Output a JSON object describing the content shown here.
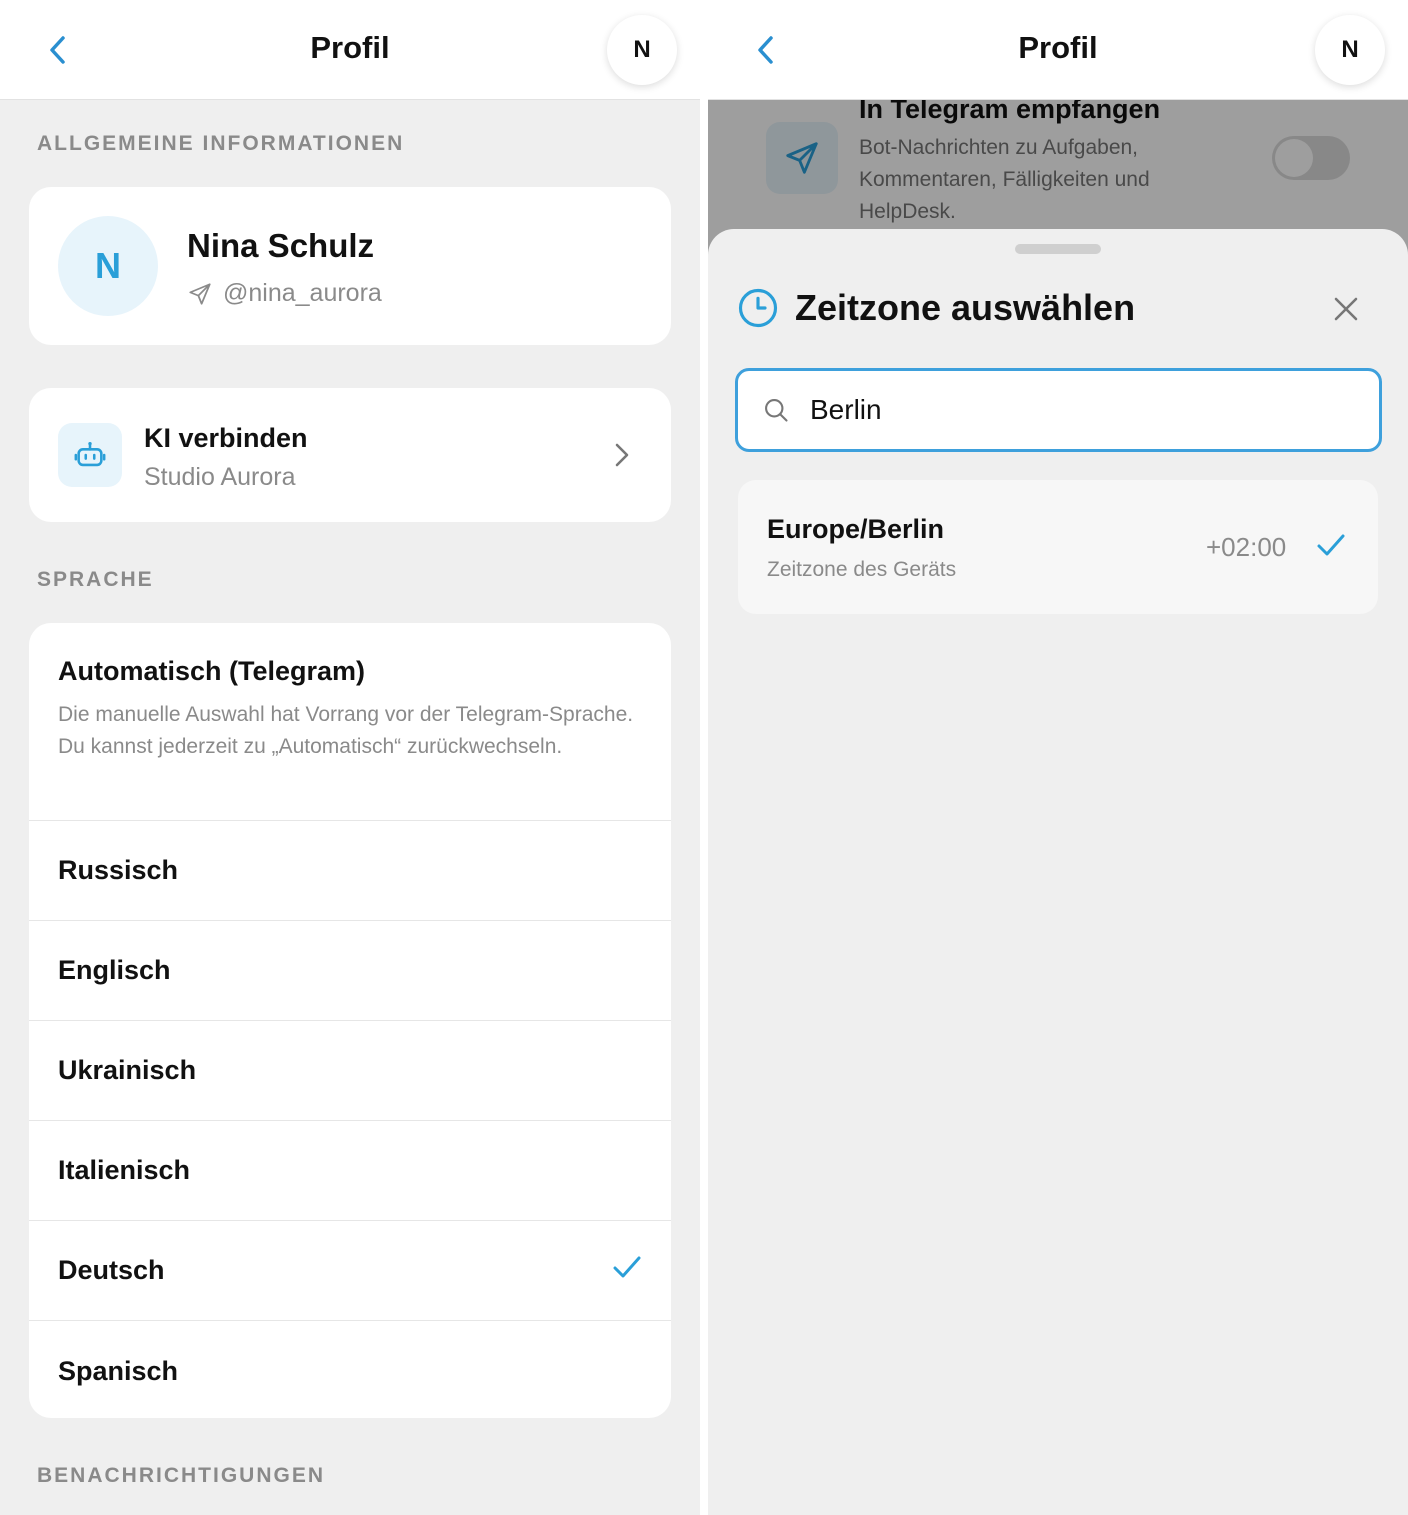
{
  "left": {
    "header": {
      "title": "Profil",
      "avatar_letter": "N"
    },
    "general": {
      "section_label": "ALLGEMEINE INFORMATIONEN",
      "profile": {
        "initial": "N",
        "name": "Nina Schulz",
        "handle": "@nina_aurora"
      },
      "ki": {
        "title": "KI verbinden",
        "subtitle": "Studio Aurora"
      }
    },
    "language": {
      "section_label": "SPRACHE",
      "auto": {
        "title": "Automatisch (Telegram)",
        "description": "Die manuelle Auswahl hat Vorrang vor der Telegram-Sprache. Du kannst jederzeit zu „Automatisch“ zurückwechseln."
      },
      "options": [
        "Russisch",
        "Englisch",
        "Ukrainisch",
        "Italienisch",
        "Deutsch",
        "Spanisch"
      ],
      "selected": "Deutsch"
    },
    "notifications": {
      "section_label": "BENACHRICHTIGUNGEN"
    }
  },
  "right": {
    "header": {
      "title": "Profil",
      "avatar_letter": "N"
    },
    "background_card": {
      "title": "In Telegram empfangen",
      "description": "Bot-Nachrichten zu Aufgaben, Kommentaren, Fälligkeiten und HelpDesk.",
      "toggle_on": false
    },
    "sheet": {
      "title": "Zeitzone auswählen",
      "search": {
        "value": "Berlin"
      },
      "results": [
        {
          "name": "Europe/Berlin",
          "subtitle": "Zeitzone des Geräts",
          "offset": "+02:00",
          "selected": true
        }
      ]
    }
  },
  "colors": {
    "accent": "#2a9fd8",
    "muted_text": "#8a8a8a",
    "background": "#efefef"
  },
  "icons": [
    "back-chevron-icon",
    "send-icon",
    "robot-icon",
    "chevron-right-icon",
    "checkmark-icon",
    "clock-icon",
    "close-icon",
    "search-icon"
  ]
}
